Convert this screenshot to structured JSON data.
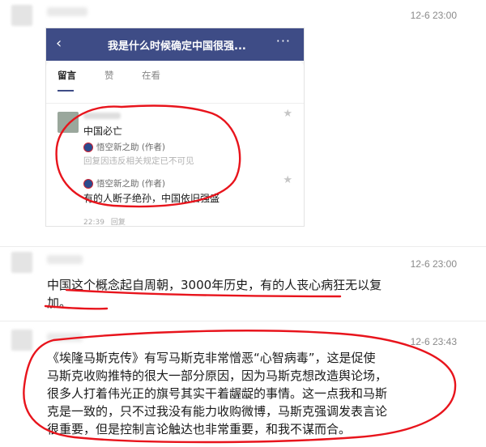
{
  "messages": [
    {
      "time": "12-6 23:00",
      "screenshot": {
        "title": "我是什么时候确定中国很强...",
        "back_icon": "chevron-left-icon",
        "more_icon": "more-icon",
        "tabs": [
          "留言",
          "赞",
          "在看"
        ],
        "comment": {
          "text": "中国必亡",
          "replies": [
            {
              "author": "悟空新之助 (作者)",
              "text": "回复因违反相关规定已不可见"
            },
            {
              "author": "悟空新之助 (作者)",
              "text": "有的人断子绝孙，中国依旧强盛"
            }
          ],
          "time": "22:39",
          "reply_label": "回复"
        }
      }
    },
    {
      "time": "12-6 23:00",
      "lines": [
        "中国这个概念起自周朝，3000年历史，有的人丧心病狂无以复",
        "加。"
      ]
    },
    {
      "time": "12-6 23:43",
      "lines": [
        "《埃隆马斯克传》有写马斯克非常憎恶“心智病毒”，这是促使",
        "马斯克收购推特的很大一部分原因，因为马斯克想改造舆论场，",
        "很多人打着伟光正的旗号其实干着龌龊的事情。这一点我和马斯",
        "克是一致的，只不过我没有能力收购微博，马斯克强调发表言论",
        "很重要，但是控制言论触达也非常重要，和我不谋而合。"
      ]
    }
  ],
  "colors": {
    "annotation": "#e8141c",
    "header": "#3e4c86"
  }
}
